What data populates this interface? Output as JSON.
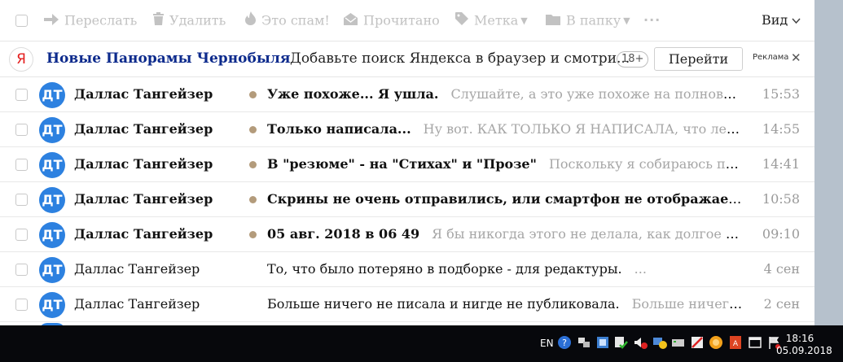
{
  "toolbar": {
    "forward": "Переслать",
    "delete": "Удалить",
    "spam": "Это спам!",
    "read": "Прочитано",
    "label": "Метка",
    "folder": "В папку",
    "more": "···",
    "view": "Вид"
  },
  "ad": {
    "logo": "Я",
    "title": "Новые Панорамы Чернобыля",
    "text": "Добавьте поиск Яндекса в браузер и смотри...",
    "age": "18+",
    "button": "Перейти",
    "label": "Реклама",
    "close": "✕"
  },
  "messages": [
    {
      "avatar": "ДТ",
      "sender": "Даллас Тангейзер",
      "unread": true,
      "subject": "Уже похоже... Я ушла.",
      "preview": "Слушайте, а это уже похоже на полновесную с...",
      "time": "15:53"
    },
    {
      "avatar": "ДТ",
      "sender": "Даллас Тангейзер",
      "unread": true,
      "subject": "Только написала...",
      "preview": "Ну вот. КАК ТОЛЬКО Я НАПИСАЛА, что легоньк...",
      "time": "14:55"
    },
    {
      "avatar": "ДТ",
      "sender": "Даллас Тангейзер",
      "unread": true,
      "subject": "В \"резюме\" - на \"Стихах\" и \"Прозе\"",
      "preview": "Поскольку я собираюсь постав...",
      "time": "14:41"
    },
    {
      "avatar": "ДТ",
      "sender": "Даллас Тангейзер",
      "unread": true,
      "subject": "Скрины не очень отправились, или смартфон не отображает, т...",
      "preview": "",
      "time": "10:58"
    },
    {
      "avatar": "ДТ",
      "sender": "Даллас Тангейзер",
      "unread": true,
      "subject": "05 авг. 2018 в 06 49",
      "preview": "Я бы никогда этого не делала, как долгое время н...",
      "time": "09:10"
    },
    {
      "avatar": "ДТ",
      "sender": "Даллас Тангейзер",
      "unread": false,
      "subject": "То, что было потеряно в подборке - для редактуры.",
      "preview": "...",
      "time": "4 сен"
    },
    {
      "avatar": "ДТ",
      "sender": "Даллас Тангейзер",
      "unread": false,
      "subject": "Больше ничего не писала и нигде не публиковала.",
      "preview": "Больше ничего не пи...",
      "time": "2 сен"
    }
  ],
  "taskbar": {
    "language": "EN",
    "time": "18:16",
    "date": "05.09.2018",
    "tray_icons": [
      "help-icon",
      "network-icon",
      "app-icon",
      "check-shield-icon",
      "volume-muted-icon",
      "network-monitor-icon",
      "disk-icon",
      "ban-icon",
      "orange-circle-icon",
      "pdf-icon",
      "window-icon",
      "flag-icon"
    ]
  },
  "colors": {
    "avatar": "#2d81e0",
    "unread_dot": "#b39b7b",
    "ad_title": "#0c2a8c",
    "toolbar_disabled": "#c2c2c2"
  }
}
